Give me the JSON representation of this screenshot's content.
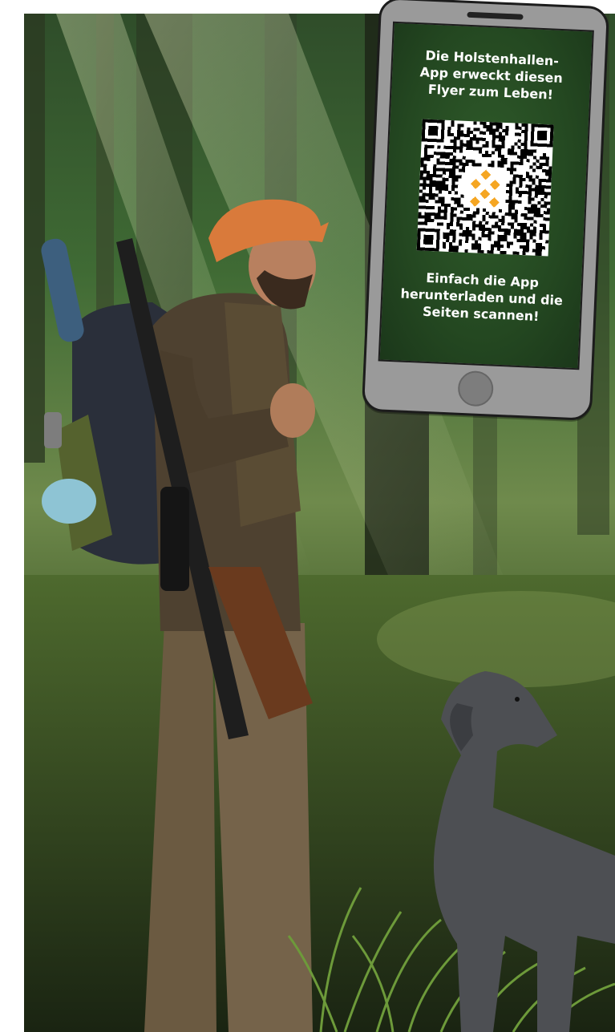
{
  "flyer": {
    "phone_screen": {
      "headline": "Die Holstenhallen-\nApp erweckt diesen\nFlyer zum Leben!",
      "call_to_action": "Einfach die App\nherunterladen und die\nSeiten scannen!",
      "qr_logo_color": "#f5a623",
      "screen_color": "#244821"
    },
    "photo": {
      "subjects": [
        "hunter-figure",
        "hunting-dog",
        "forest-background"
      ]
    }
  }
}
